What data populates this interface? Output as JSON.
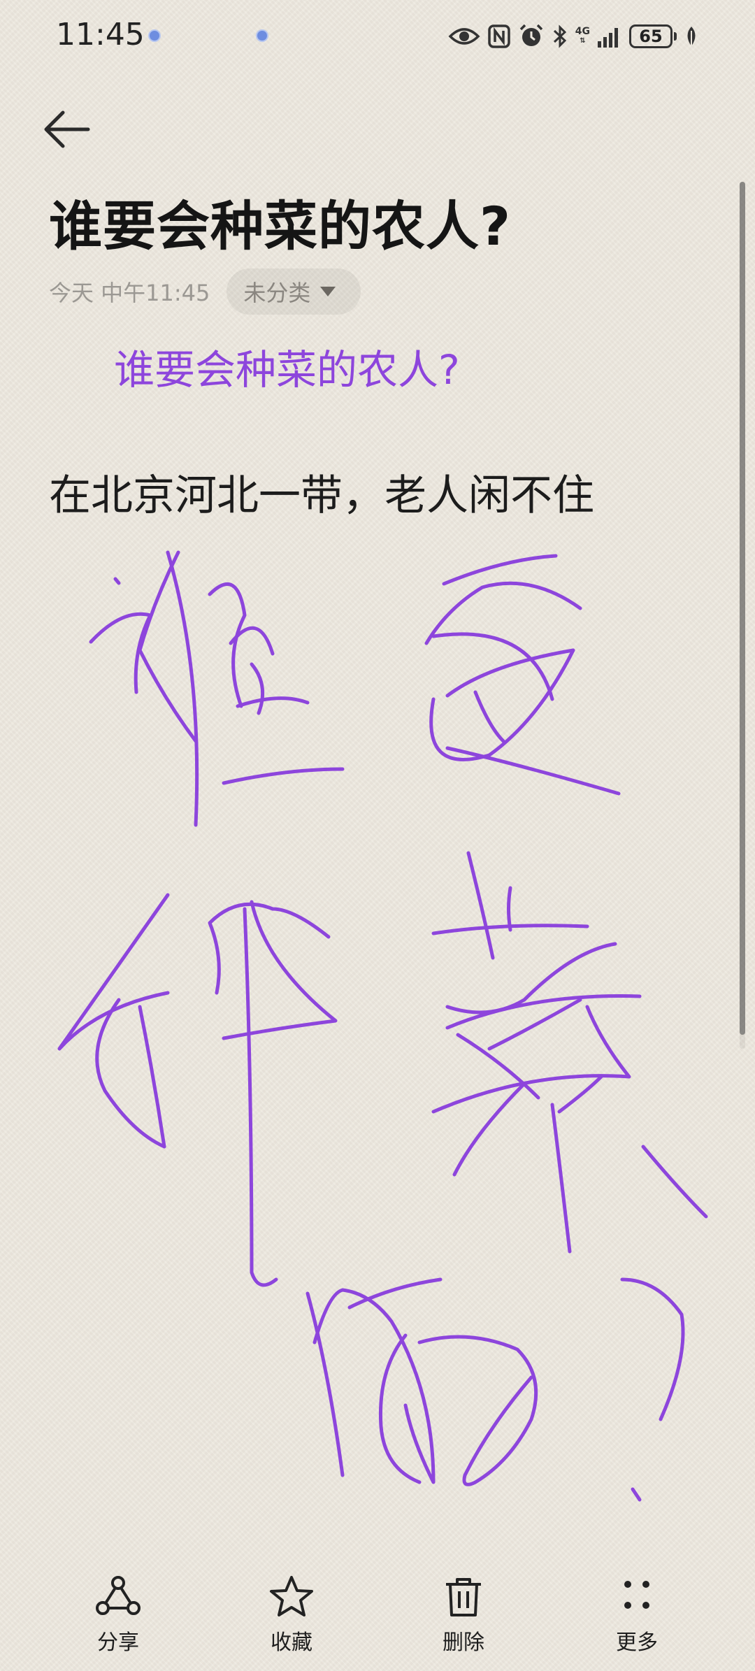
{
  "status_bar": {
    "time": "11:45",
    "network": "4G",
    "battery": "65"
  },
  "note": {
    "title": "谁要会种菜的农人?",
    "date": "今天 中午11:45",
    "category": "未分类",
    "heading": "谁要会种菜的农人?",
    "body": "在北京河北一带，老人闲不住"
  },
  "ink_color": "#8d45dc",
  "toolbar": {
    "share": "分享",
    "favorite": "收藏",
    "delete": "删除",
    "more": "更多"
  }
}
